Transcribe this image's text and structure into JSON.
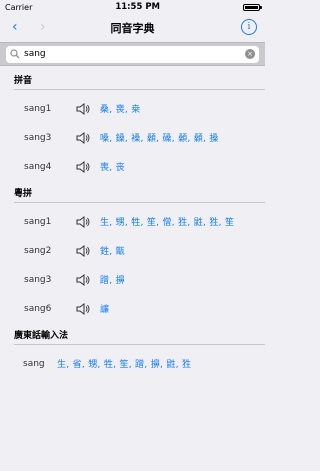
{
  "status": {
    "carrier": "Carrier",
    "time": "11:55 PM"
  },
  "nav": {
    "title": "同音字典",
    "back": "‹",
    "forward": "›",
    "info": "i"
  },
  "search": {
    "value": "sang",
    "clear": "×"
  },
  "sections": {
    "pinyin": {
      "title": "拼音",
      "rows": [
        {
          "label": "sang1",
          "chars": "桑, 喪, 桒"
        },
        {
          "label": "sang3",
          "chars": "嗓, 鎟, 褬, 顙, 磉, 顙, 顙, 搡"
        },
        {
          "label": "sang4",
          "chars": "喪, 丧"
        }
      ]
    },
    "jyutping": {
      "title": "粵拼",
      "rows": [
        {
          "label": "sang1",
          "chars": "生, 甥, 牲, 笙, 僧, 狌, 鼪, 狌, 笙"
        },
        {
          "label": "sang2",
          "chars": "鉎, 甑"
        },
        {
          "label": "sang3",
          "chars": "蹭, 擤"
        },
        {
          "label": "sang6",
          "chars": "譧"
        }
      ]
    },
    "cantonese_ime": {
      "title": "廣東話輸入法",
      "rows": [
        {
          "label": "sang",
          "chars": "生, 省, 甥, 牲, 笙, 蹭, 擤, 鼪, 狌"
        }
      ]
    }
  }
}
